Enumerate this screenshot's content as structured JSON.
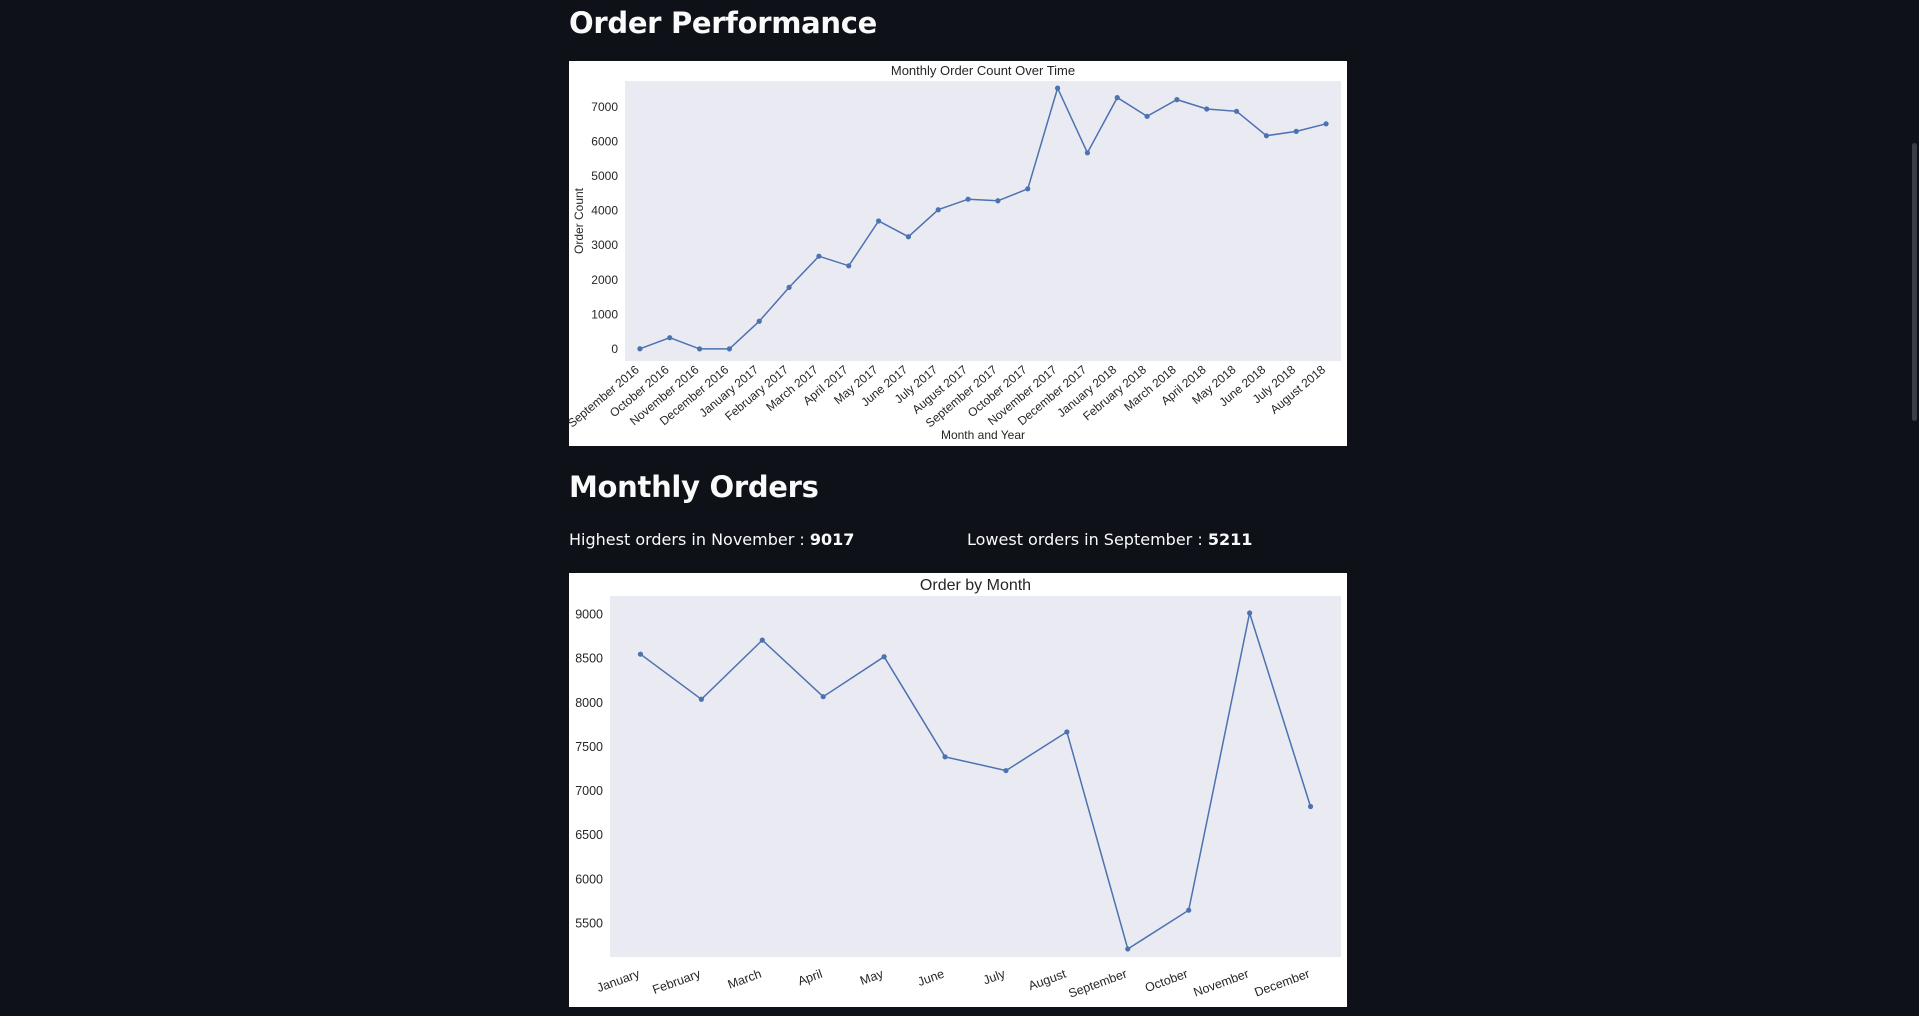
{
  "sections": {
    "performance_title": "Order Performance",
    "monthly_title": "Monthly Orders"
  },
  "metrics": {
    "highest_label": "Highest orders in November : ",
    "highest_value": "9017",
    "lowest_label": "Lowest orders in September : ",
    "lowest_value": "5211"
  },
  "colors": {
    "line": "#4c72b0",
    "plot_bg": "#eaeaf2",
    "page_bg": "#0e1117"
  },
  "chart_data": [
    {
      "type": "line",
      "title": "Monthly Order Count Over Time",
      "xlabel": "Month and Year",
      "ylabel": "Order Count",
      "categories": [
        "September 2016",
        "October 2016",
        "November 2016",
        "December 2016",
        "January 2017",
        "February 2017",
        "March 2017",
        "April 2017",
        "May 2017",
        "June 2017",
        "July 2017",
        "August 2017",
        "September 2017",
        "October 2017",
        "November 2017",
        "December 2017",
        "January 2018",
        "February 2018",
        "March 2018",
        "April 2018",
        "May 2018",
        "June 2018",
        "July 2018",
        "August 2018"
      ],
      "values": [
        4,
        324,
        0,
        1,
        800,
        1780,
        2682,
        2404,
        3700,
        3245,
        4026,
        4331,
        4285,
        4631,
        7544,
        5673,
        7269,
        6728,
        7211,
        6939,
        6873,
        6167,
        6292,
        6512
      ],
      "yticks": [
        0,
        1000,
        2000,
        3000,
        4000,
        5000,
        6000,
        7000
      ],
      "ylim": [
        -350,
        7750
      ],
      "grid": false
    },
    {
      "type": "line",
      "title": "Order by Month",
      "xlabel": "",
      "ylabel": "",
      "categories": [
        "January",
        "February",
        "March",
        "April",
        "May",
        "June",
        "July",
        "August",
        "September",
        "October",
        "November",
        "December"
      ],
      "values": [
        8551,
        8040,
        8710,
        8069,
        8522,
        7388,
        7232,
        7670,
        5211,
        5650,
        9017,
        6825
      ],
      "yticks": [
        5500,
        6000,
        6500,
        7000,
        7500,
        8000,
        8500,
        9000
      ],
      "ylim": [
        5120,
        9210
      ],
      "grid": false
    }
  ]
}
